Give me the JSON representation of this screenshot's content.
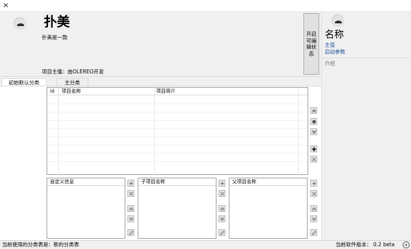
{
  "window": {
    "close_glyph": "×"
  },
  "app": {
    "title": "扑美",
    "description": "扑美是一款",
    "owner_label": "项目主循：由OLEREO开发",
    "edit_button_label": "开启可编辑状态"
  },
  "tabs": [
    {
      "label": "初始默认分类",
      "active": true
    },
    {
      "label": "主分类",
      "active": false
    }
  ],
  "project_table": {
    "columns": [
      "id",
      "项目名称",
      "项目简介"
    ],
    "rows": []
  },
  "custom_info_table": {
    "columns": [
      "自定义信息"
    ]
  },
  "sub_project_table": {
    "columns": [
      "子项目名称"
    ]
  },
  "parent_project_table": {
    "columns": [
      "父项目名称"
    ]
  },
  "side_buttons": {
    "top": [
      "chevron-double-up-icon",
      "record-icon",
      "chevron-double-down-icon",
      "add-icon",
      "delete-icon"
    ],
    "small": [
      "add-icon",
      "delete-icon",
      "chevron-double-up-icon",
      "chevron-double-down-icon",
      "edit-icon"
    ]
  },
  "right_panel": {
    "title": "名称",
    "value_link": "主值",
    "param_link": "启动参数",
    "intro_label": "介绍"
  },
  "status": {
    "current_category": "当前使用的分类表是：新的分类表",
    "version": "当前软件版本：  0.2 beta"
  },
  "colors": {
    "link": "#1a4e96",
    "window_bg": "#f0f0f0",
    "grid_border": "#a0a0a0"
  }
}
